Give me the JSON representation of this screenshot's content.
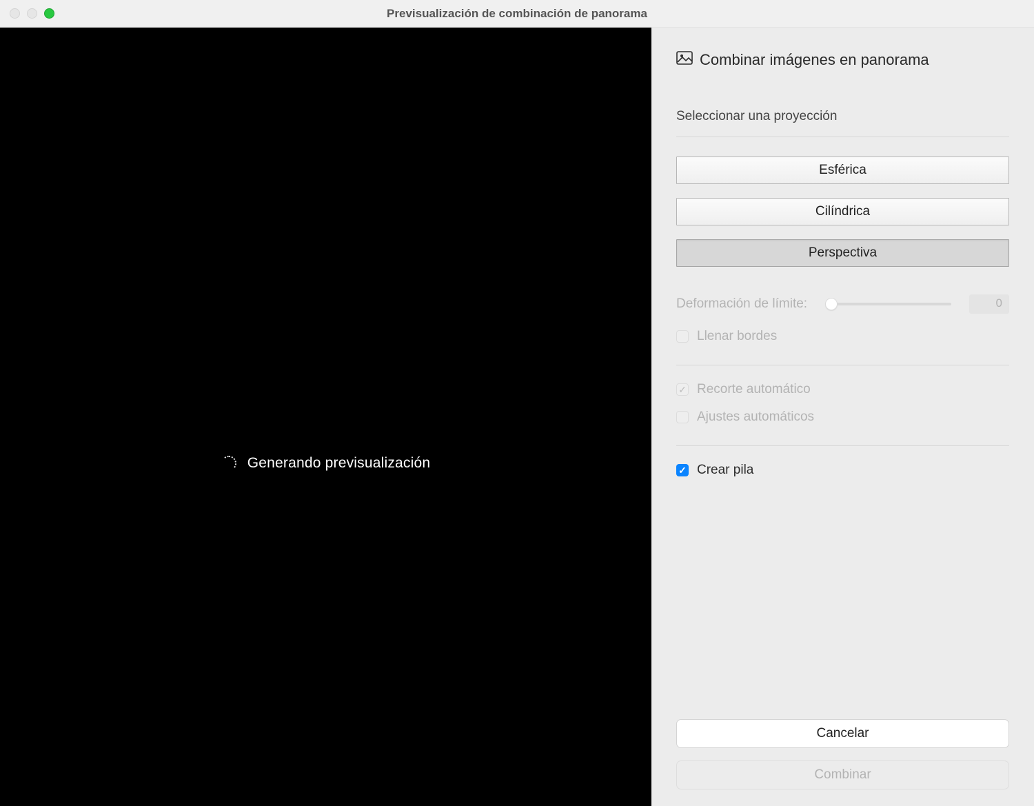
{
  "window": {
    "title": "Previsualización de combinación de panorama"
  },
  "preview": {
    "status_text": "Generando previsualización"
  },
  "panel": {
    "header": "Combinar imágenes en panorama",
    "projection": {
      "section_label": "Seleccionar una proyección",
      "spherical": "Esférica",
      "cylindrical": "Cilíndrica",
      "perspective": "Perspectiva",
      "selected": "perspective"
    },
    "boundary": {
      "label": "Deformación de límite:",
      "value": "0"
    },
    "fill_edges": {
      "label": "Llenar bordes",
      "checked": false,
      "enabled": false
    },
    "auto_crop": {
      "label": "Recorte automático",
      "checked": true,
      "enabled": false
    },
    "auto_settings": {
      "label": "Ajustes automáticos",
      "checked": false,
      "enabled": false
    },
    "create_stack": {
      "label": "Crear pila",
      "checked": true,
      "enabled": true
    },
    "buttons": {
      "cancel": "Cancelar",
      "merge": "Combinar"
    }
  }
}
